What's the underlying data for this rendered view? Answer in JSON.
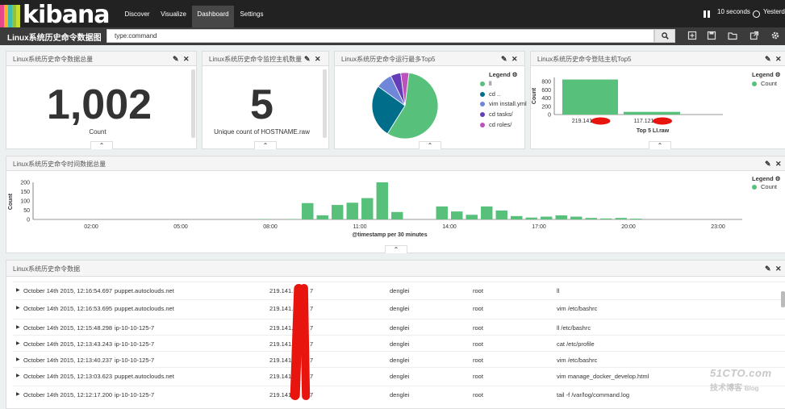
{
  "app": {
    "logo_text": "kibana",
    "logo_colors": [
      "#e8488b",
      "#f6b02d",
      "#3ebeb0",
      "#8cc43f",
      "#c7dc30"
    ],
    "nav": [
      {
        "label": "Discover"
      },
      {
        "label": "Visualize"
      },
      {
        "label": "Dashboard",
        "active": true
      },
      {
        "label": "Settings"
      }
    ],
    "refresh_label": "10 seconds",
    "time_label": "Yesterday"
  },
  "dashboard": {
    "title": "Linux系统历史命令数据图",
    "query": "type:command"
  },
  "panels": {
    "total": {
      "title": "Linux系统历史命令数据总量",
      "value": "1,002",
      "label": "Count"
    },
    "hosts": {
      "title": "Linux系统历史命令监控主机数量",
      "value": "5",
      "label": "Unique count of HOSTNAME.raw"
    },
    "top_commands": {
      "title": "Linux系统历史命令运行最多Top5",
      "legend_title": "Legend",
      "items": [
        {
          "label": "ll",
          "color": "#57c17b",
          "value": 57
        },
        {
          "label": "cd ..",
          "color": "#006e8a",
          "value": 26
        },
        {
          "label": "vim install.yml",
          "color": "#6f87d8",
          "value": 8
        },
        {
          "label": "cd tasks/",
          "color": "#663db8",
          "value": 5
        },
        {
          "label": "cd roles/",
          "color": "#bc52bc",
          "value": 4
        }
      ]
    },
    "top_hosts": {
      "title": "Linux系统历史命令登陆主机Top5",
      "legend_title": "Legend",
      "legend_item": "Count",
      "y_label": "Count",
      "y_ticks": [
        "800",
        "600",
        "400",
        "200",
        "0"
      ],
      "x_label": "Top 5 LI.raw",
      "hosts": [
        "219.141.",
        "117.121."
      ],
      "values": [
        850,
        65
      ],
      "ylim": [
        0,
        900
      ],
      "color": "#57c17b"
    },
    "timeline": {
      "title": "Linux系统历史命令时间数据总量",
      "legend_title": "Legend",
      "legend_item": "Count",
      "y_label": "Count",
      "y_ticks": [
        "200",
        "150",
        "100",
        "50",
        "0"
      ],
      "x_label": "@timestamp per 30 minutes",
      "x_ticks": [
        "02:00",
        "05:00",
        "08:00",
        "11:00",
        "14:00",
        "17:00",
        "20:00",
        "23:00"
      ],
      "color": "#57c17b"
    },
    "data_table": {
      "title": "Linux系统历史命令数据",
      "rows": [
        {
          "time": "October 14th 2015, 12:16:54.697",
          "host": "puppet.autoclouds.net",
          "ip": "219.141.",
          "ip_tail": "7",
          "user": "denglei",
          "login": "root",
          "command": "ll"
        },
        {
          "time": "October 14th 2015, 12:16:53.695",
          "host": "puppet.autoclouds.net",
          "ip": "219.141.",
          "ip_tail": "7",
          "user": "denglei",
          "login": "root",
          "command": "vim /etc/bashrc"
        },
        {
          "time": "October 14th 2015, 12:15:48.298",
          "host": "ip-10-10-125-7",
          "ip": "219.141.",
          "ip_tail": "7",
          "user": "denglei",
          "login": "root",
          "command": "ll /etc/bashrc"
        },
        {
          "time": "October 14th 2015, 12:13:43.243",
          "host": "ip-10-10-125-7",
          "ip": "219.141.",
          "ip_tail": "7",
          "user": "denglei",
          "login": "root",
          "command": "cat /etc/profile"
        },
        {
          "time": "October 14th 2015, 12:13:40.237",
          "host": "ip-10-10-125-7",
          "ip": "219.141.",
          "ip_tail": "7",
          "user": "denglei",
          "login": "root",
          "command": "vim /etc/bashrc"
        },
        {
          "time": "October 14th 2015, 12:13:03.623",
          "host": "puppet.autoclouds.net",
          "ip": "219.141.",
          "ip_tail": "7",
          "user": "denglei",
          "login": "root",
          "command": "vim manage_docker_develop.html"
        },
        {
          "time": "October 14th 2015, 12:12:17.200",
          "host": "ip-10-10-125-7",
          "ip": "219.141.",
          "ip_tail": "7",
          "user": "denglei",
          "login": "root",
          "command": "tail -f /var/log/command.log"
        }
      ]
    }
  },
  "chart_data": [
    {
      "type": "pie",
      "categories": [
        "ll",
        "cd ..",
        "vim install.yml",
        "cd tasks/",
        "cd roles/"
      ],
      "values": [
        57,
        26,
        8,
        5,
        4
      ]
    },
    {
      "type": "bar",
      "categories": [
        "219.141.",
        "117.121."
      ],
      "values": [
        850,
        65
      ],
      "xlabel": "Top 5 LI.raw",
      "ylabel": "Count",
      "ylim": [
        0,
        900
      ]
    },
    {
      "type": "bar",
      "xlabel": "@timestamp per 30 minutes",
      "ylabel": "Count",
      "ylim": [
        0,
        200
      ],
      "x": [
        "07:30",
        "08:30",
        "09:00",
        "09:30",
        "10:00",
        "10:30",
        "11:00",
        "11:30",
        "12:00",
        "13:30",
        "14:00",
        "14:30",
        "15:00",
        "15:30",
        "16:00",
        "16:30",
        "17:00",
        "17:30",
        "18:00",
        "18:30",
        "19:00",
        "19:30",
        "20:00"
      ],
      "values": [
        2,
        2,
        88,
        22,
        78,
        90,
        115,
        200,
        40,
        70,
        43,
        25,
        70,
        48,
        18,
        10,
        15,
        22,
        15,
        8,
        5,
        8,
        4
      ]
    }
  ]
}
